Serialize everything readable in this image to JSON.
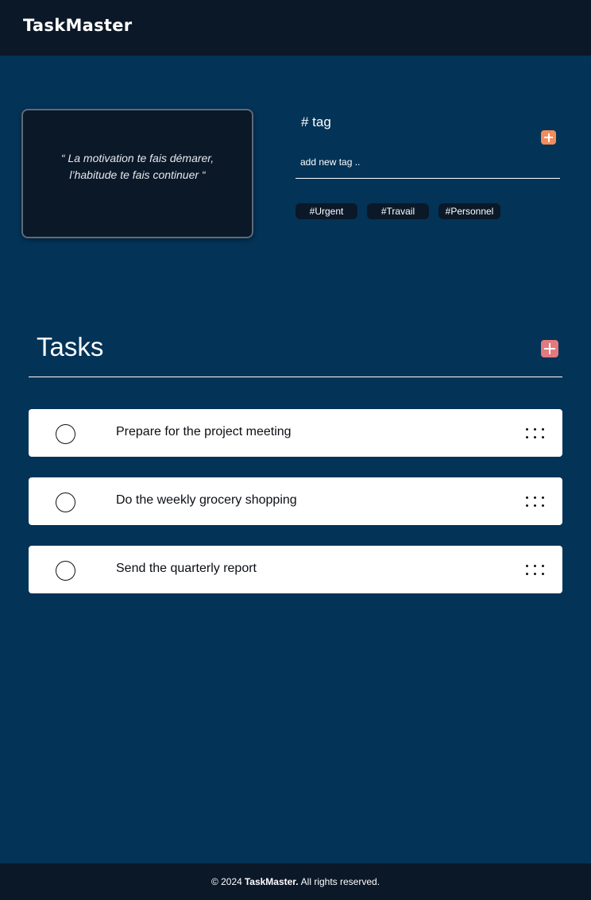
{
  "header": {
    "title": "TaskMaster"
  },
  "quote": {
    "text": "“ La motivation te fais démarer,\nl’habitude te fais continuer  “"
  },
  "tags": {
    "title": "# tag",
    "input_placeholder": "add new tag ..",
    "add_icon": "plus-icon",
    "chips": [
      "#Urgent",
      "#Travail",
      "#Personnel"
    ]
  },
  "tasks": {
    "title": "Tasks",
    "add_icon": "plus-icon",
    "items": [
      {
        "label": "Prepare for the project meeting"
      },
      {
        "label": "Do the weekly grocery shopping"
      },
      {
        "label": "Send the quarterly report"
      }
    ]
  },
  "footer": {
    "prefix": "© 2024",
    "brand": "TaskMaster.",
    "suffix": "All rights reserved."
  },
  "colors": {
    "background": "#033357",
    "header_footer": "#0b1828",
    "tag_add": "#f28c5c",
    "task_add": "#e27a7e",
    "task_card": "#ffffff"
  }
}
